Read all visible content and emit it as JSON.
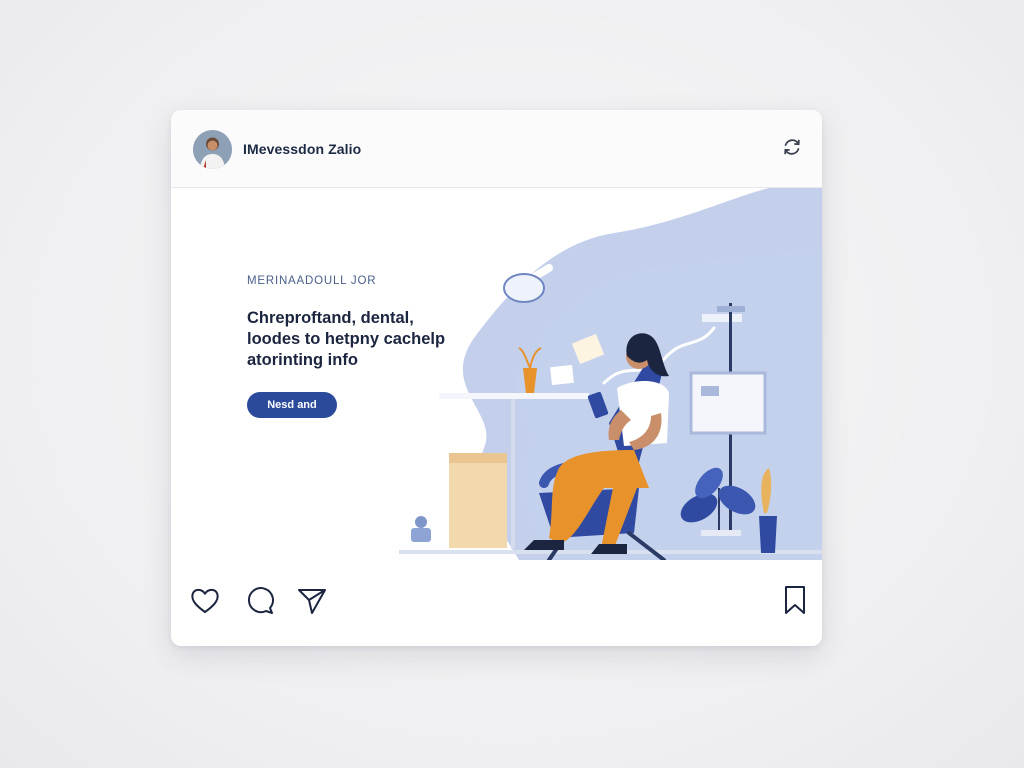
{
  "post": {
    "username": "IMevessdon Zalio",
    "eyebrow": "MERINAADOULL JOR",
    "headline_lines": [
      "Chreproftand, dental,",
      "loodes to hetpny cachelp",
      "atorinting info"
    ],
    "cta_label": "Nesd and"
  },
  "icons": {
    "header_action": "refresh-icon",
    "like": "heart-icon",
    "comment": "comment-icon",
    "share": "send-icon",
    "save": "bookmark-icon"
  },
  "colors": {
    "accent": "#2c4a9c",
    "illustration_blob": "#b7c6e6",
    "chair": "#2f4aa0",
    "pants": "#e8922b",
    "text_dark": "#1c2540"
  }
}
